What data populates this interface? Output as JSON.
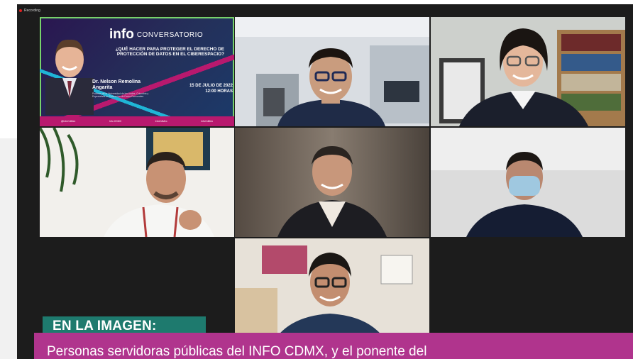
{
  "meeting": {
    "recording_label": "Recording"
  },
  "poster": {
    "logo_mark": "info",
    "event_type": "CONVERSATORIO",
    "question": "¿QUÉ HACER PARA PROTEGER EL DERECHO DE PROTECCIÓN DE DATOS EN EL CIBERESPACIO?",
    "speaker_name": "Dr. Nelson Remolina Angarita",
    "speaker_description": "Profesor de la Universidad de los Andes, Colombia y Especialista en Protección de Datos Personales",
    "date": "15 DE JULIO DE 2022",
    "time": "12:00 HORAS",
    "footer_items": [
      "@InfoCdMex",
      "Info CDMX",
      "InfoCdMex",
      "InfoCdMex"
    ]
  },
  "participants": [
    {
      "label": "participant-2"
    },
    {
      "label": "participant-3"
    },
    {
      "label": "participant-4"
    },
    {
      "label": "participant-5"
    },
    {
      "label": "participant-6"
    },
    {
      "label": "participant-7"
    }
  ],
  "banner": {
    "tag": "EN LA IMAGEN:",
    "caption": "Personas servidoras públicas del INFO CDMX, y el ponente del"
  },
  "colors": {
    "active_speaker_border": "#77d26b",
    "banner_tag_bg": "#1e7a6e",
    "banner_caption_bg": "#b0348d",
    "poster_accent": "#b8196e"
  }
}
